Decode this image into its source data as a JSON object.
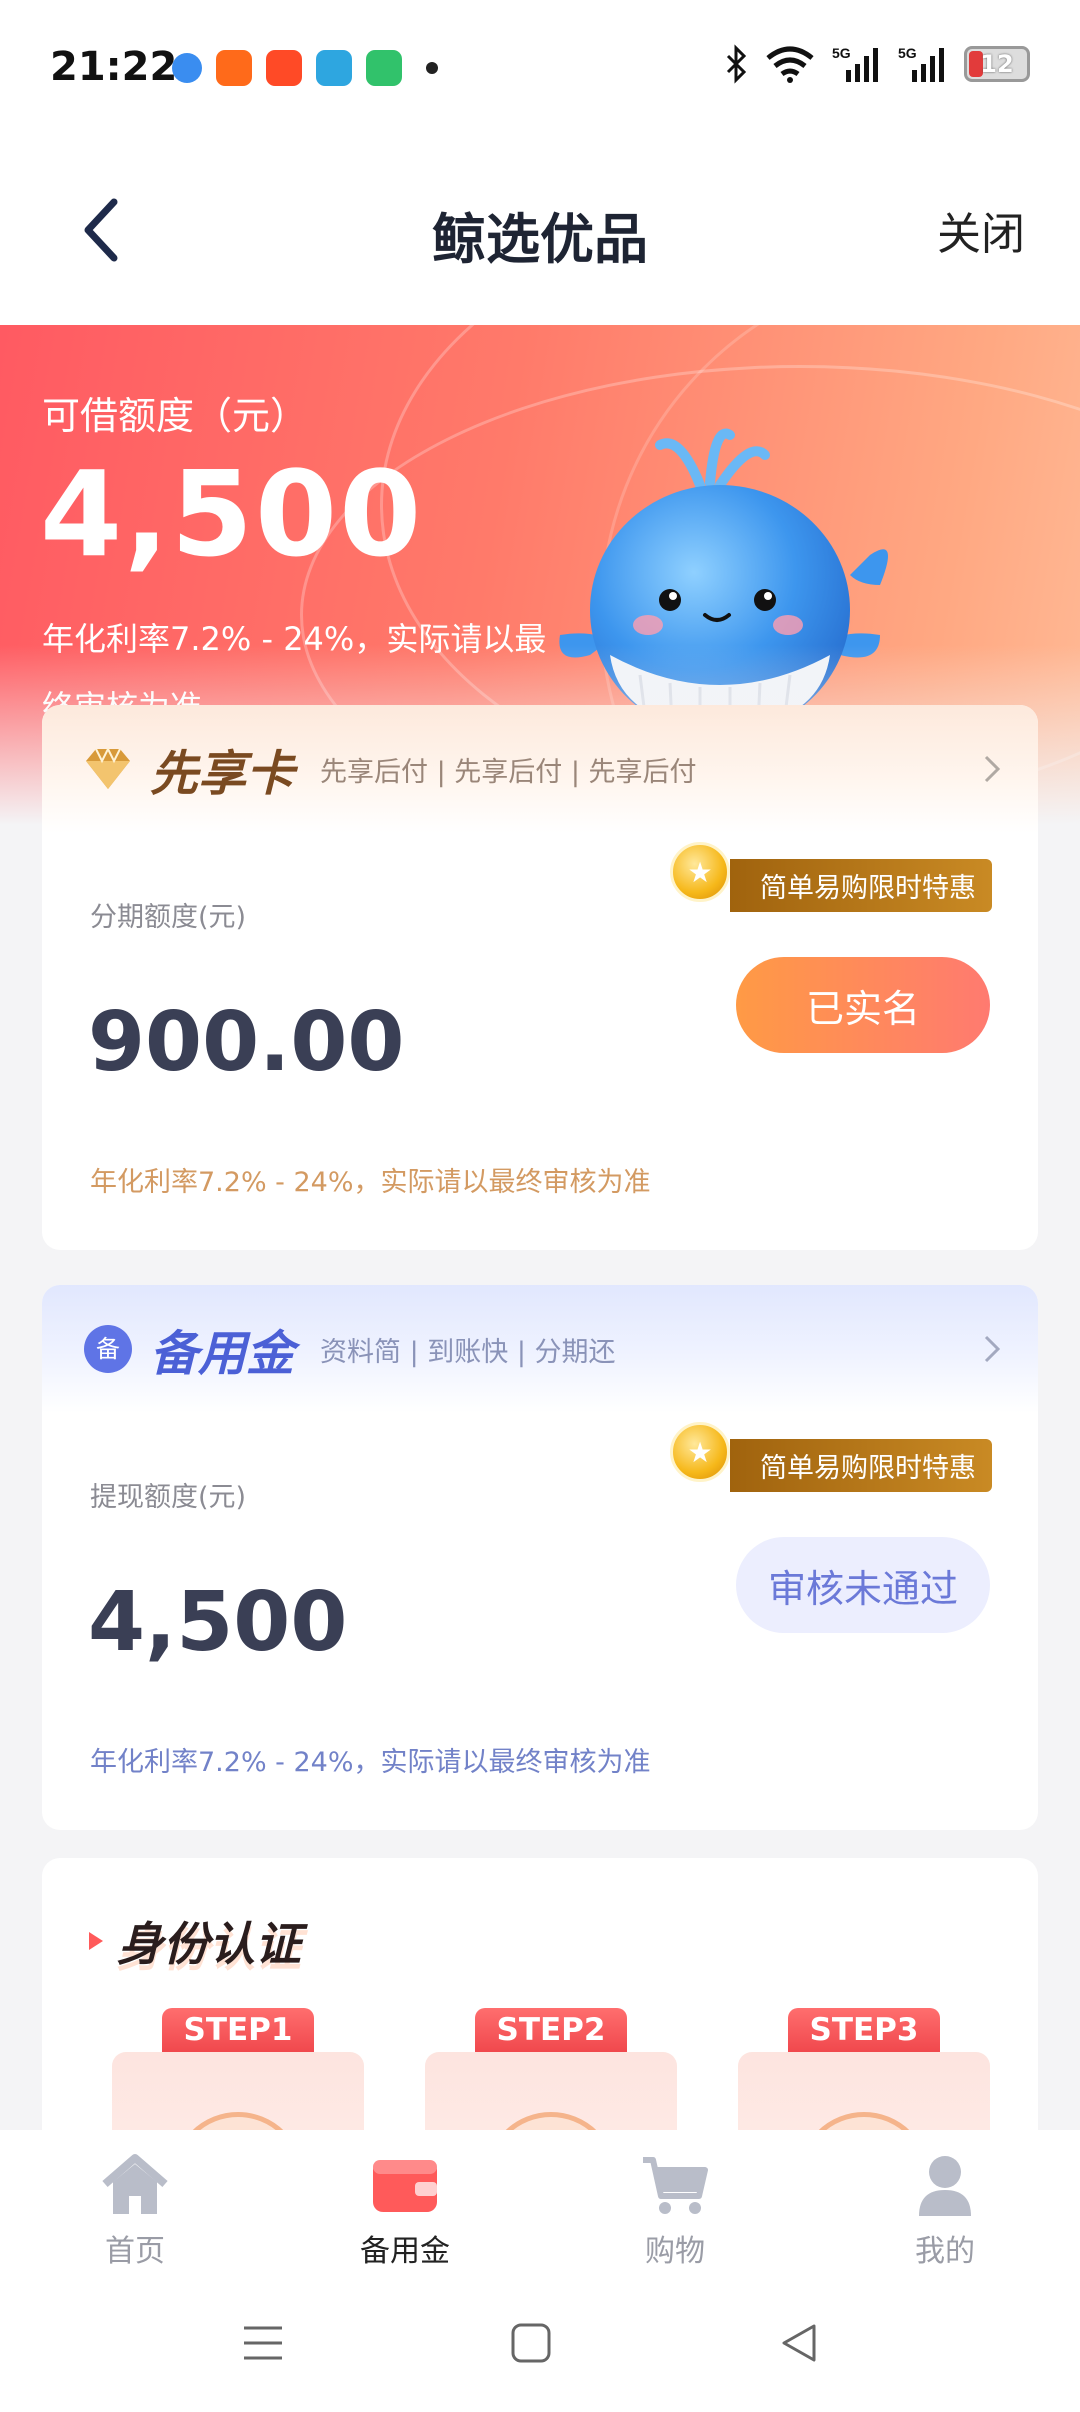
{
  "status_bar": {
    "time": "21:22",
    "battery": "12",
    "icons": [
      "bluetooth-icon",
      "wifi-icon",
      "5g-signal-icon",
      "5g-signal-icon",
      "battery-icon"
    ]
  },
  "header": {
    "title": "鲸选优品",
    "close_label": "关闭"
  },
  "hero": {
    "label": "可借额度（元）",
    "amount": "4,500",
    "note": "年化利率7.2% - 24%，实际请以最终审核为准"
  },
  "card1": {
    "brand": "先享卡",
    "tags": "先享后付 | 先享后付 | 先享后付",
    "promo": "简单易购限时特惠",
    "limit_label": "分期额度(元)",
    "limit_amount": "900.00",
    "button": "已实名",
    "rate_note": "年化利率7.2% - 24%，实际请以最终审核为准"
  },
  "card2": {
    "brand": "备用金",
    "tags": "资料简 | 到账快 | 分期还",
    "promo": "简单易购限时特惠",
    "limit_label": "提现额度(元)",
    "limit_amount": "4,500",
    "button": "审核未通过",
    "rate_note": "年化利率7.2% - 24%，实际请以最终审核为准"
  },
  "identity": {
    "title": "身份认证",
    "steps": [
      "STEP1",
      "STEP2",
      "STEP3"
    ]
  },
  "bottom_nav": {
    "items": [
      {
        "label": "首页"
      },
      {
        "label": "备用金"
      },
      {
        "label": "购物"
      },
      {
        "label": "我的"
      }
    ],
    "active": "备用金"
  },
  "colors": {
    "accent_red": "#ff5a62",
    "orange_button": "#ff9a45",
    "purple": "#6b79d8",
    "gold": "#c98a24"
  }
}
